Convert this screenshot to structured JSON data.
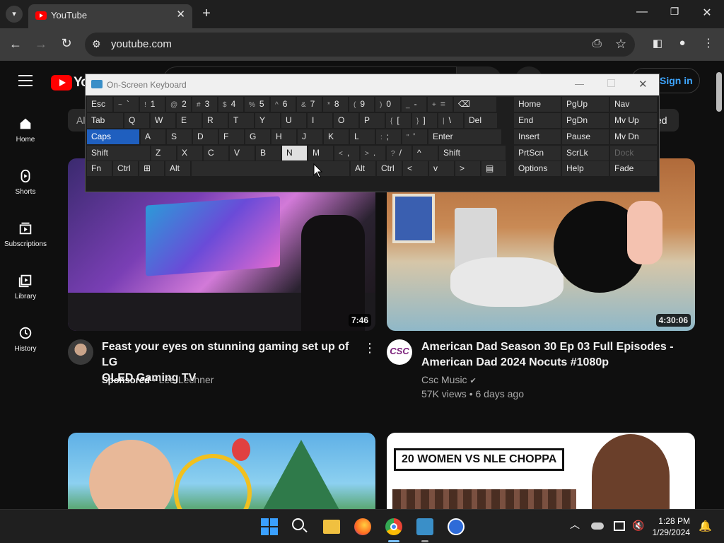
{
  "browser": {
    "tab_title": "YouTube",
    "url": "youtube.com"
  },
  "youtube": {
    "logo_text": "Yo",
    "sign_in": "Sign in",
    "chip_all": "Al",
    "chip_partial": "ed",
    "sidebar": [
      {
        "label": "Home"
      },
      {
        "label": "Shorts"
      },
      {
        "label": "Subscriptions"
      },
      {
        "label": "Library"
      },
      {
        "label": "History"
      }
    ],
    "videos": [
      {
        "title_line1": "Feast your eyes on stunning gaming set up of LG",
        "title_line2": "OLED Gaming TV",
        "sponsored": "Sponsored",
        "channel": "Lee Lechner",
        "duration": "7:46"
      },
      {
        "title_line1": "American Dad Season 30 Ep 03 Full Episodes -",
        "title_line2": "American Dad 2024 Nocuts #1080p",
        "channel": "Csc Music",
        "stats": "57K views • 6 days ago",
        "duration": "4:30:06",
        "avatar_text": "CSC"
      },
      {
        "thumb_text": ""
      },
      {
        "thumb_text": "20 WOMEN VS NLE CHOPPA"
      }
    ]
  },
  "osk": {
    "title": "On-Screen Keyboard",
    "rows": [
      [
        {
          "l": "Esc"
        },
        {
          "s": "~",
          "l": "`"
        },
        {
          "s": "!",
          "l": "1"
        },
        {
          "s": "@",
          "l": "2"
        },
        {
          "s": "#",
          "l": "3"
        },
        {
          "s": "$",
          "l": "4"
        },
        {
          "s": "%",
          "l": "5"
        },
        {
          "s": "^",
          "l": "6"
        },
        {
          "s": "&",
          "l": "7"
        },
        {
          "s": "*",
          "l": "8"
        },
        {
          "s": "(",
          "l": "9"
        },
        {
          "s": ")",
          "l": "0"
        },
        {
          "s": "_",
          "l": "-"
        },
        {
          "s": "+",
          "l": "="
        },
        {
          "l": "⌫"
        }
      ],
      [
        {
          "l": "Tab"
        },
        {
          "l": "Q"
        },
        {
          "l": "W"
        },
        {
          "l": "E"
        },
        {
          "l": "R"
        },
        {
          "l": "T"
        },
        {
          "l": "Y"
        },
        {
          "l": "U"
        },
        {
          "l": "I"
        },
        {
          "l": "O"
        },
        {
          "l": "P"
        },
        {
          "s": "{",
          "l": "["
        },
        {
          "s": "}",
          "l": "]"
        },
        {
          "s": "|",
          "l": "\\"
        },
        {
          "l": "Del"
        }
      ],
      [
        {
          "l": "Caps"
        },
        {
          "l": "A"
        },
        {
          "l": "S"
        },
        {
          "l": "D"
        },
        {
          "l": "F"
        },
        {
          "l": "G"
        },
        {
          "l": "H"
        },
        {
          "l": "J"
        },
        {
          "l": "K"
        },
        {
          "l": "L"
        },
        {
          "s": ":",
          "l": ";"
        },
        {
          "s": "\"",
          "l": "'"
        },
        {
          "l": "Enter"
        }
      ],
      [
        {
          "l": "Shift"
        },
        {
          "l": "Z"
        },
        {
          "l": "X"
        },
        {
          "l": "C"
        },
        {
          "l": "V"
        },
        {
          "l": "B"
        },
        {
          "l": "N"
        },
        {
          "l": "M"
        },
        {
          "s": "<",
          "l": ","
        },
        {
          "s": ">",
          "l": "."
        },
        {
          "s": "?",
          "l": "/"
        },
        {
          "l": "^"
        },
        {
          "l": "Shift"
        }
      ],
      [
        {
          "l": "Fn"
        },
        {
          "l": "Ctrl"
        },
        {
          "l": "⊞"
        },
        {
          "l": "Alt"
        },
        {
          "l": ""
        },
        {
          "l": "Alt"
        },
        {
          "l": "Ctrl"
        },
        {
          "l": "<"
        },
        {
          "l": "v"
        },
        {
          "l": ">"
        },
        {
          "l": "▤"
        }
      ]
    ],
    "right": [
      [
        "Home",
        "PgUp",
        "Nav"
      ],
      [
        "End",
        "PgDn",
        "Mv Up"
      ],
      [
        "Insert",
        "Pause",
        "Mv Dn"
      ],
      [
        "PrtScn",
        "ScrLk",
        "Dock"
      ],
      [
        "Options",
        "Help",
        "Fade"
      ]
    ]
  },
  "taskbar": {
    "time": "1:28 PM",
    "date": "1/29/2024"
  },
  "colors": {
    "accent": "#1f5fbf",
    "youtube_red": "#ff0000"
  }
}
